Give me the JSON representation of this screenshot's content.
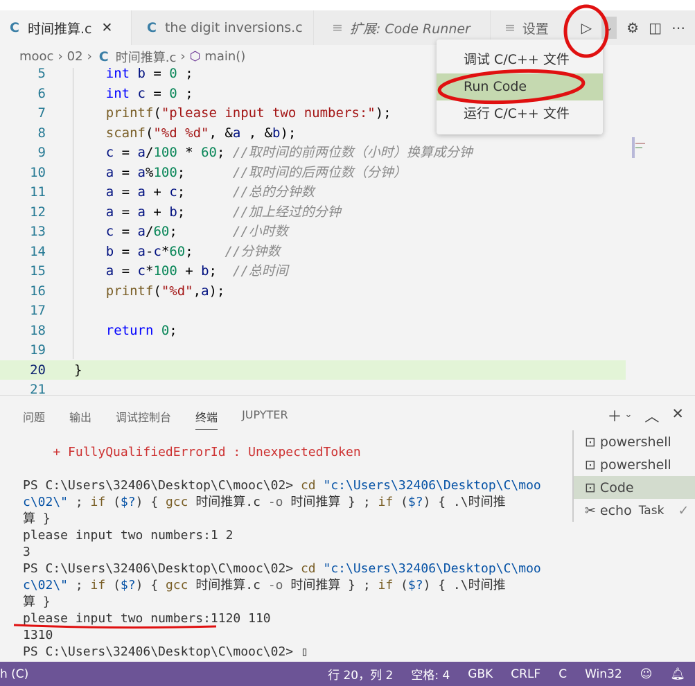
{
  "tabs": [
    {
      "icon": "c-file-icon",
      "label": "时间推算.c",
      "active": true,
      "close": "✕"
    },
    {
      "icon": "c-file-icon",
      "label": "the digit inversions.c"
    },
    {
      "icon": "preview-icon",
      "label": "扩展: Code Runner",
      "italic": true
    },
    {
      "icon": "preview-icon",
      "label": "设置"
    }
  ],
  "breadcrumb": [
    "mooc",
    "02",
    "时间推算.c",
    "main()"
  ],
  "run_menu": {
    "items": [
      "调试 C/C++ 文件",
      "Run Code",
      "运行 C/C++ 文件"
    ],
    "selected": 1
  },
  "editor": {
    "current_line": 20,
    "lines": [
      {
        "n": "5",
        "t": [
          [
            "kw",
            "    int "
          ],
          [
            "var",
            "b"
          ],
          [
            "op",
            " = "
          ],
          [
            "num",
            "0"
          ],
          [
            "op",
            " ;"
          ]
        ]
      },
      {
        "n": "6",
        "t": [
          [
            "kw",
            "    int "
          ],
          [
            "var",
            "c"
          ],
          [
            "op",
            " = "
          ],
          [
            "num",
            "0"
          ],
          [
            "op",
            " ;"
          ]
        ]
      },
      {
        "n": "7",
        "t": [
          [
            "fn",
            "    printf"
          ],
          [
            "op",
            "("
          ],
          [
            "str",
            "\"please input two numbers:\""
          ],
          [
            "op",
            ");"
          ]
        ]
      },
      {
        "n": "8",
        "t": [
          [
            "fn",
            "    scanf"
          ],
          [
            "op",
            "("
          ],
          [
            "str",
            "\"%d %d\""
          ],
          [
            "op",
            ", &"
          ],
          [
            "var",
            "a"
          ],
          [
            "op",
            " , &"
          ],
          [
            "var",
            "b"
          ],
          [
            "op",
            ");"
          ]
        ]
      },
      {
        "n": "9",
        "t": [
          [
            "var",
            "    c"
          ],
          [
            "op",
            " = "
          ],
          [
            "var",
            "a"
          ],
          [
            "op",
            "/"
          ],
          [
            "num",
            "100"
          ],
          [
            "op",
            " * "
          ],
          [
            "num",
            "60"
          ],
          [
            "op",
            "; "
          ],
          [
            "cm",
            "//取时间的前两位数（小时）换算成分钟"
          ]
        ]
      },
      {
        "n": "10",
        "t": [
          [
            "var",
            "    a"
          ],
          [
            "op",
            " = "
          ],
          [
            "var",
            "a"
          ],
          [
            "op",
            "%"
          ],
          [
            "num",
            "100"
          ],
          [
            "op",
            ";      "
          ],
          [
            "cm",
            "//取时间的后两位数（分钟）"
          ]
        ]
      },
      {
        "n": "11",
        "t": [
          [
            "var",
            "    a"
          ],
          [
            "op",
            " = "
          ],
          [
            "var",
            "a"
          ],
          [
            "op",
            " + "
          ],
          [
            "var",
            "c"
          ],
          [
            "op",
            ";      "
          ],
          [
            "cm",
            "//总的分钟数"
          ]
        ]
      },
      {
        "n": "12",
        "t": [
          [
            "var",
            "    a"
          ],
          [
            "op",
            " = "
          ],
          [
            "var",
            "a"
          ],
          [
            "op",
            " + "
          ],
          [
            "var",
            "b"
          ],
          [
            "op",
            ";      "
          ],
          [
            "cm",
            "//加上经过的分钟"
          ]
        ]
      },
      {
        "n": "13",
        "t": [
          [
            "var",
            "    c"
          ],
          [
            "op",
            " = "
          ],
          [
            "var",
            "a"
          ],
          [
            "op",
            "/"
          ],
          [
            "num",
            "60"
          ],
          [
            "op",
            ";       "
          ],
          [
            "cm",
            "//小时数"
          ]
        ]
      },
      {
        "n": "14",
        "t": [
          [
            "var",
            "    b"
          ],
          [
            "op",
            " = "
          ],
          [
            "var",
            "a"
          ],
          [
            "op",
            "-"
          ],
          [
            "var",
            "c"
          ],
          [
            "op",
            "*"
          ],
          [
            "num",
            "60"
          ],
          [
            "op",
            ";    "
          ],
          [
            "cm",
            "//分钟数"
          ]
        ]
      },
      {
        "n": "15",
        "t": [
          [
            "var",
            "    a"
          ],
          [
            "op",
            " = "
          ],
          [
            "var",
            "c"
          ],
          [
            "op",
            "*"
          ],
          [
            "num",
            "100"
          ],
          [
            "op",
            " + "
          ],
          [
            "var",
            "b"
          ],
          [
            "op",
            ";  "
          ],
          [
            "cm",
            "//总时间"
          ]
        ]
      },
      {
        "n": "16",
        "t": [
          [
            "fn",
            "    printf"
          ],
          [
            "op",
            "("
          ],
          [
            "str",
            "\"%d\""
          ],
          [
            "op",
            ","
          ],
          [
            "var",
            "a"
          ],
          [
            "op",
            ");"
          ]
        ]
      },
      {
        "n": "17",
        "t": []
      },
      {
        "n": "18",
        "t": [
          [
            "kw",
            "    return "
          ],
          [
            "num",
            "0"
          ],
          [
            "op",
            ";"
          ]
        ]
      },
      {
        "n": "19",
        "t": []
      },
      {
        "n": "20",
        "t": [
          [
            "op",
            "}"
          ]
        ]
      },
      {
        "n": "21",
        "t": []
      }
    ]
  },
  "panel": {
    "tabs": [
      "问题",
      "输出",
      "调试控制台",
      "终端",
      "JUPYTER"
    ],
    "active": 3
  },
  "terminal": {
    "lines": [
      [
        [
          "err",
          "    + FullyQualifiedErrorId : UnexpectedToken"
        ]
      ],
      [],
      [
        [
          "n",
          "PS C:\\Users\\32406\\Desktop\\C\\mooc\\02> "
        ],
        [
          "y",
          "cd "
        ],
        [
          "s",
          "\"c:\\Users\\32406\\Desktop\\C\\moo"
        ]
      ],
      [
        [
          "s",
          "c\\02\\\""
        ],
        [
          "n",
          " ; "
        ],
        [
          "y",
          "if "
        ],
        [
          "n",
          "("
        ],
        [
          "s",
          "$?"
        ],
        [
          "n",
          ") { "
        ],
        [
          "y",
          "gcc "
        ],
        [
          "n",
          "时间推算.c "
        ],
        [
          "c",
          "-o "
        ],
        [
          "n",
          "时间推算 } ; "
        ],
        [
          "y",
          "if "
        ],
        [
          "n",
          "("
        ],
        [
          "s",
          "$?"
        ],
        [
          "n",
          ") { .\\时间推"
        ]
      ],
      [
        [
          "n",
          "算 }"
        ]
      ],
      [
        [
          "n",
          "please input two numbers:1 2"
        ]
      ],
      [
        [
          "n",
          "3"
        ]
      ],
      [
        [
          "n",
          "PS C:\\Users\\32406\\Desktop\\C\\mooc\\02> "
        ],
        [
          "y",
          "cd "
        ],
        [
          "s",
          "\"c:\\Users\\32406\\Desktop\\C\\moo"
        ]
      ],
      [
        [
          "s",
          "c\\02\\\""
        ],
        [
          "n",
          " ; "
        ],
        [
          "y",
          "if "
        ],
        [
          "n",
          "("
        ],
        [
          "s",
          "$?"
        ],
        [
          "n",
          ") { "
        ],
        [
          "y",
          "gcc "
        ],
        [
          "n",
          "时间推算.c "
        ],
        [
          "c",
          "-o "
        ],
        [
          "n",
          "时间推算 } ; "
        ],
        [
          "y",
          "if "
        ],
        [
          "n",
          "("
        ],
        [
          "s",
          "$?"
        ],
        [
          "n",
          ") { .\\时间推"
        ]
      ],
      [
        [
          "n",
          "算 }"
        ]
      ],
      [
        [
          "n",
          "please input two numbers:1120 110"
        ]
      ],
      [
        [
          "n",
          "1310"
        ]
      ],
      [
        [
          "n",
          "PS C:\\Users\\32406\\Desktop\\C\\mooc\\02> "
        ],
        [
          "n",
          "▯"
        ]
      ]
    ]
  },
  "terminal_list": [
    {
      "icon": "terminal-icon",
      "label": "powershell"
    },
    {
      "icon": "terminal-icon",
      "label": "powershell"
    },
    {
      "icon": "terminal-icon",
      "label": "Code",
      "selected": true
    },
    {
      "icon": "tools-icon",
      "label": "echo",
      "sub": "Task",
      "check": "✓"
    }
  ],
  "status": {
    "left": "h (C)",
    "items": [
      "行 20，列 2",
      "空格: 4",
      "GBK",
      "CRLF",
      "C",
      "Win32"
    ]
  },
  "colors": {
    "status_bar": "#6c5496",
    "annotation": "#e01010",
    "selected_menu": "#c5d9b0"
  }
}
